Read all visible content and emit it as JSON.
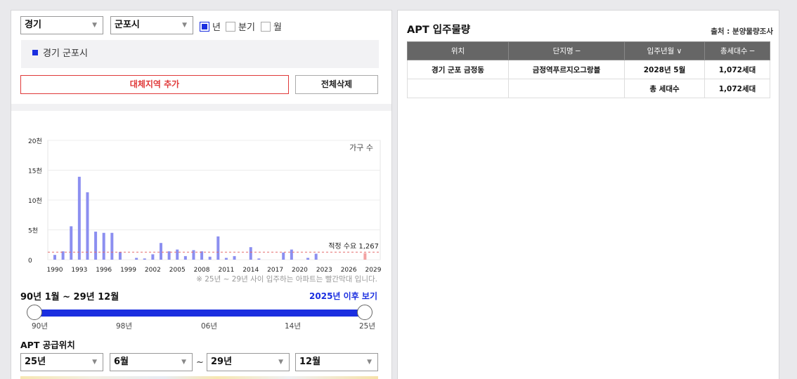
{
  "filters": {
    "province": "경기",
    "city": "군포시",
    "period_options": [
      {
        "label": "년",
        "checked": true
      },
      {
        "label": "분기",
        "checked": false
      },
      {
        "label": "월",
        "checked": false
      }
    ]
  },
  "region": {
    "selected": "경기 군포시"
  },
  "buttons": {
    "add_region": "대체지역 추가",
    "delete_all": "전체삭제"
  },
  "chart_data": {
    "type": "bar",
    "legend": "가구 수",
    "x": [
      1990,
      1991,
      1992,
      1993,
      1994,
      1995,
      1996,
      1997,
      1998,
      1999,
      2000,
      2001,
      2002,
      2003,
      2004,
      2005,
      2006,
      2007,
      2008,
      2009,
      2010,
      2011,
      2012,
      2013,
      2014,
      2015,
      2016,
      2017,
      2018,
      2019,
      2020,
      2021,
      2022,
      2023,
      2024,
      2025,
      2026,
      2027,
      2028
    ],
    "values": [
      800,
      1400,
      5600,
      13900,
      11300,
      4700,
      4500,
      4500,
      1300,
      0,
      300,
      200,
      900,
      2800,
      1400,
      1700,
      600,
      1600,
      1400,
      500,
      3900,
      300,
      600,
      0,
      2100,
      200,
      0,
      0,
      1200,
      1700,
      0,
      300,
      1000,
      0,
      0,
      0,
      0,
      0,
      1100
    ],
    "highlight_from": 2025,
    "x_tick_labels": [
      "1990",
      "1993",
      "1996",
      "1999",
      "2002",
      "2005",
      "2008",
      "2011",
      "2014",
      "2017",
      "2020",
      "2023",
      "2026",
      "2029"
    ],
    "y_tick_labels": [
      "0",
      "5천",
      "10천",
      "15천",
      "20천"
    ],
    "ylim": [
      0,
      20000
    ],
    "reference_line": {
      "value": 1267,
      "label": "적정 수요 1,267"
    },
    "colors": {
      "bar": "#8c8ff0",
      "highlight": "#f3a3a3",
      "reference": "#e56b6b"
    }
  },
  "note": "※ 25년 ~ 29년 사이 입주하는 아파트는 빨간막대 입니다.",
  "range": {
    "title": "90년 1월 ~ 29년 12월",
    "link": "2025년 이후 보기",
    "ticks": [
      "90년",
      "98년",
      "06년",
      "14년",
      "25년"
    ]
  },
  "supply": {
    "title": "APT 공급위치",
    "from_year": "25년",
    "from_month": "6월",
    "tilde": "~",
    "to_year": "29년",
    "to_month": "12월"
  },
  "right_panel": {
    "title": "APT 입주물량",
    "source": "출처 : 분양물량조사",
    "headers": [
      "위치",
      "단지명 ─",
      "입주년월 ∨",
      "총세대수 ─"
    ],
    "rows": [
      [
        "경기 군포 금정동",
        "금정역푸르지오그랑블",
        "2028년 5월",
        "1,072세대"
      ],
      [
        "",
        "",
        "총 세대수",
        "1,072세대"
      ]
    ]
  }
}
